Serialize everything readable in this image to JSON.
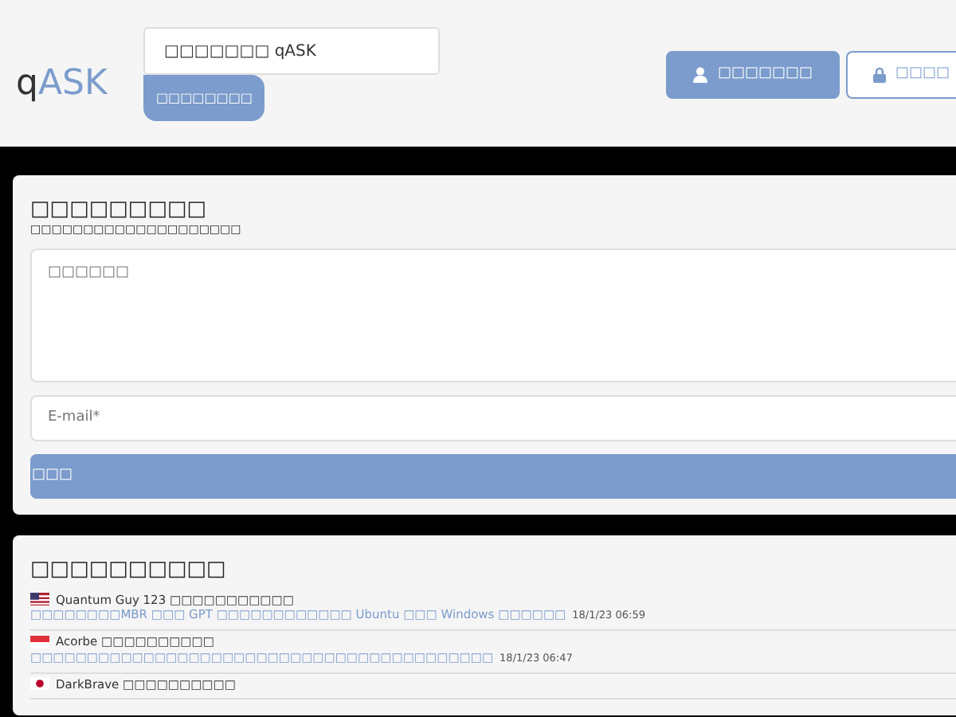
{
  "header": {
    "logo": {
      "prefix": "q",
      "accent": "ASK"
    },
    "search": {
      "value": "□□□□□□□ qASK"
    },
    "search_button": "□□□□□□□□",
    "buttons": [
      {
        "label": "□□□□□□□",
        "kind": "primary"
      },
      {
        "label": "□□□□",
        "kind": "outline"
      }
    ]
  },
  "ask_form": {
    "title": "□□□□□□□□□",
    "subtitle": "□□□□□□□□□□□□□□□□□□□□",
    "question": {
      "placeholder": "□□□□□□"
    },
    "email": {
      "placeholder": "E-mail*"
    },
    "submit": "□□□"
  },
  "recent": {
    "title": "□□□□□□□□□□",
    "items": [
      {
        "author": "Quantum Guy 123 □□□□□□□□□□□",
        "question": "□□□□□□□□MBR □□□ GPT □□□□□□□□□□□□ Ubuntu □□□ Windows □□□□□□",
        "time": "18/1/23 06:59"
      },
      {
        "author": "Acorbe □□□□□□□□□□",
        "question": "□□□□□□□□□□□□□□□□□□□□□□□□□□□□□□□□□□□□□□□□□",
        "time": "18/1/23 06:47"
      },
      {
        "author": "DarkBrave □□□□□□□□□□"
      }
    ]
  }
}
